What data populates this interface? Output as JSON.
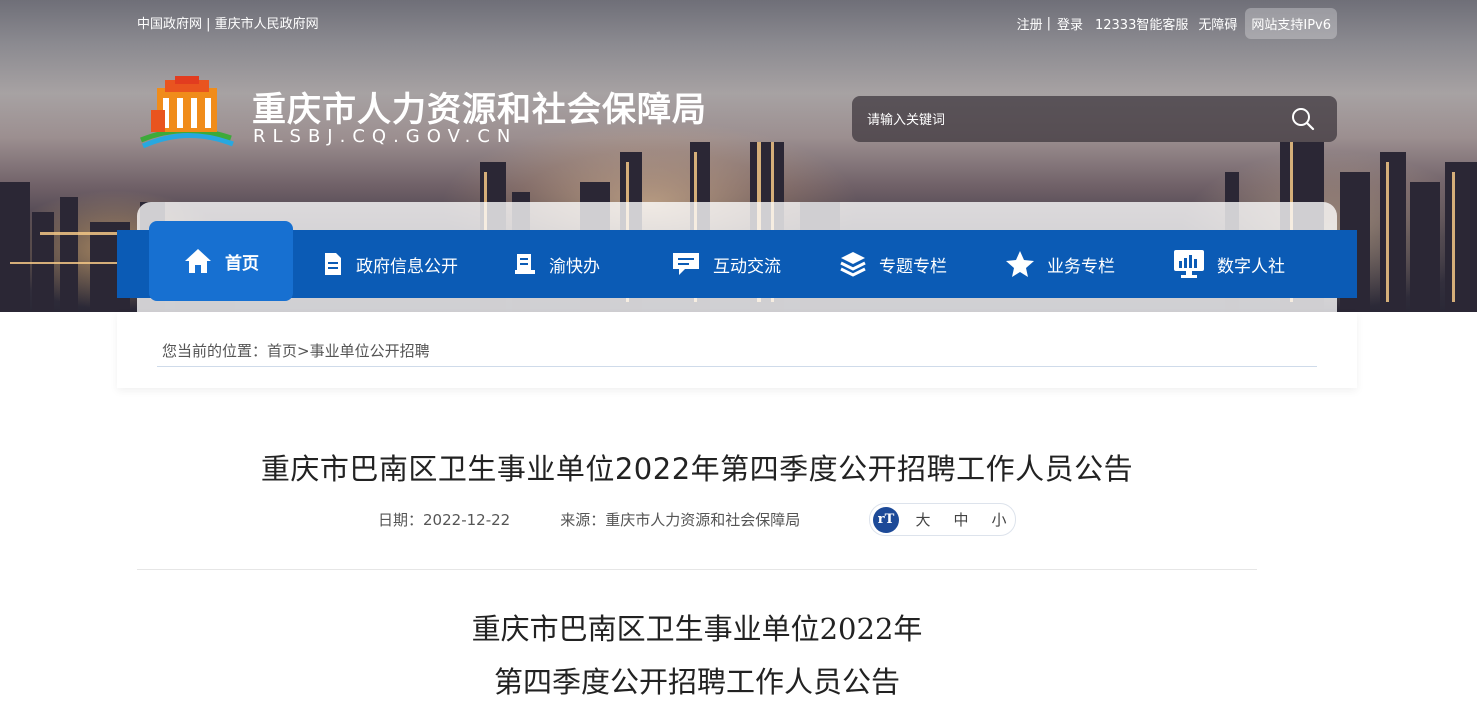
{
  "topbar": {
    "left_links": [
      "中国政府网",
      "重庆市人民政府网"
    ],
    "separator": " | ",
    "right_links": [
      "注册",
      "登录",
      "12333智能客服",
      "无障碍"
    ],
    "ipv6": "网站支持IPv6"
  },
  "site": {
    "name": "重庆市人力资源和社会保障局",
    "url": "RLSBJ.CQ.GOV.CN"
  },
  "search": {
    "placeholder": "请输入关键词"
  },
  "nav": [
    {
      "label": "首页",
      "icon": "home-icon"
    },
    {
      "label": "政府信息公开",
      "icon": "document-icon"
    },
    {
      "label": "渝快办",
      "icon": "clipboard-icon"
    },
    {
      "label": "互动交流",
      "icon": "chat-icon"
    },
    {
      "label": "专题专栏",
      "icon": "layers-icon"
    },
    {
      "label": "业务专栏",
      "icon": "star-icon"
    },
    {
      "label": "数字人社",
      "icon": "monitor-chart-icon"
    }
  ],
  "breadcrumb": {
    "prefix": "您当前的位置：",
    "home": "首页",
    "sep": ">",
    "current": "事业单位公开招聘"
  },
  "article": {
    "title": "重庆市巴南区卫生事业单位2022年第四季度公开招聘工作人员公告",
    "date_label": "日期：",
    "date": "2022-12-22",
    "source_label": "来源：",
    "source": "重庆市人力资源和社会保障局",
    "font_icon": "rT",
    "font_sizes": [
      "大",
      "中",
      "小"
    ],
    "body_title_line1": "重庆市巴南区卫生事业单位2022年",
    "body_title_line2": "第四季度公开招聘工作人员公告"
  }
}
